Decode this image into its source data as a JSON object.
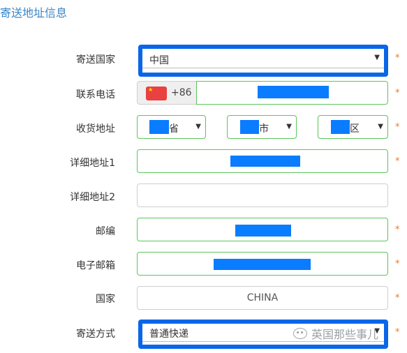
{
  "section_title": "寄送地址信息",
  "required_mark": "*",
  "form": {
    "country": {
      "label": "寄送国家",
      "value": "中国"
    },
    "phone": {
      "label": "联系电话",
      "country_code": "+86"
    },
    "address": {
      "label": "收货地址",
      "province_suffix": "省",
      "city_suffix": "市",
      "district_suffix": "区"
    },
    "address1": {
      "label": "详细地址1"
    },
    "address2": {
      "label": "详细地址2"
    },
    "zipcode": {
      "label": "邮编"
    },
    "email": {
      "label": "电子邮箱"
    },
    "nation": {
      "label": "国家",
      "value": "CHINA"
    },
    "shipping": {
      "label": "寄送方式",
      "value": "普通快递"
    }
  },
  "watermark": {
    "text": "英国那些事儿",
    "icon": "wechat-icon"
  },
  "colors": {
    "accent": "#3a86c8",
    "valid_border": "#5cc55c",
    "required": "#f07a23",
    "redaction": "#0a7cff",
    "highlight": "#0a66e8"
  }
}
